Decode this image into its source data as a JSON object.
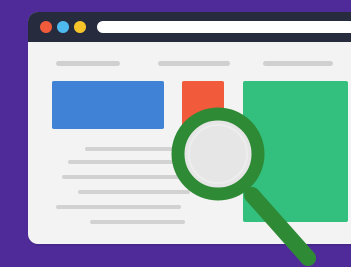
{
  "scene": {
    "colors": {
      "background": "#4e2b99",
      "window_bg": "#f3f3f3",
      "titlebar": "#272b3e",
      "dot_red": "#f15a3a",
      "dot_blue": "#4eb9ef",
      "dot_yellow": "#f7c52a",
      "blue_block": "#3f82d6",
      "orange_block": "#f15a3a",
      "green_block": "#33c07f",
      "lens_ring": "#2f8a36",
      "lens_glass": "#e6e6e6",
      "handle": "#2f8a36"
    },
    "icons": [
      "window-dot-red-icon",
      "window-dot-blue-icon",
      "window-dot-yellow-icon",
      "magnifying-glass-icon"
    ]
  }
}
